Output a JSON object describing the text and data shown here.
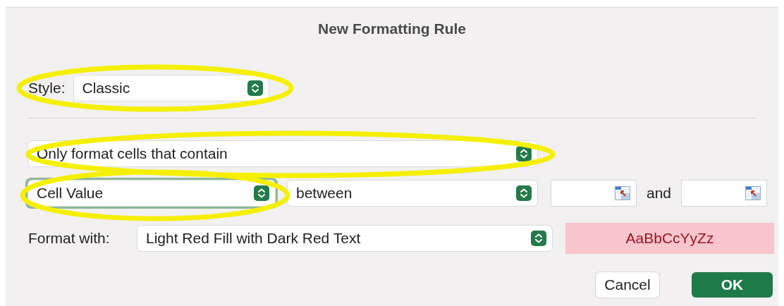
{
  "window": {
    "title": "New Formatting Rule"
  },
  "style": {
    "label": "Style:",
    "value": "Classic"
  },
  "rule_type": {
    "value": "Only format cells that contain"
  },
  "condition": {
    "subject": {
      "value": "Cell Value",
      "focused": true
    },
    "operator": {
      "value": "between"
    },
    "and_label": "and"
  },
  "format_with": {
    "label": "Format with:",
    "value": "Light Red Fill with Dark Red Text",
    "preview": "AaBbCcYyZz"
  },
  "buttons": [
    {
      "label": "Cancel",
      "kind": "secondary"
    },
    {
      "label": "OK",
      "kind": "default"
    }
  ]
}
